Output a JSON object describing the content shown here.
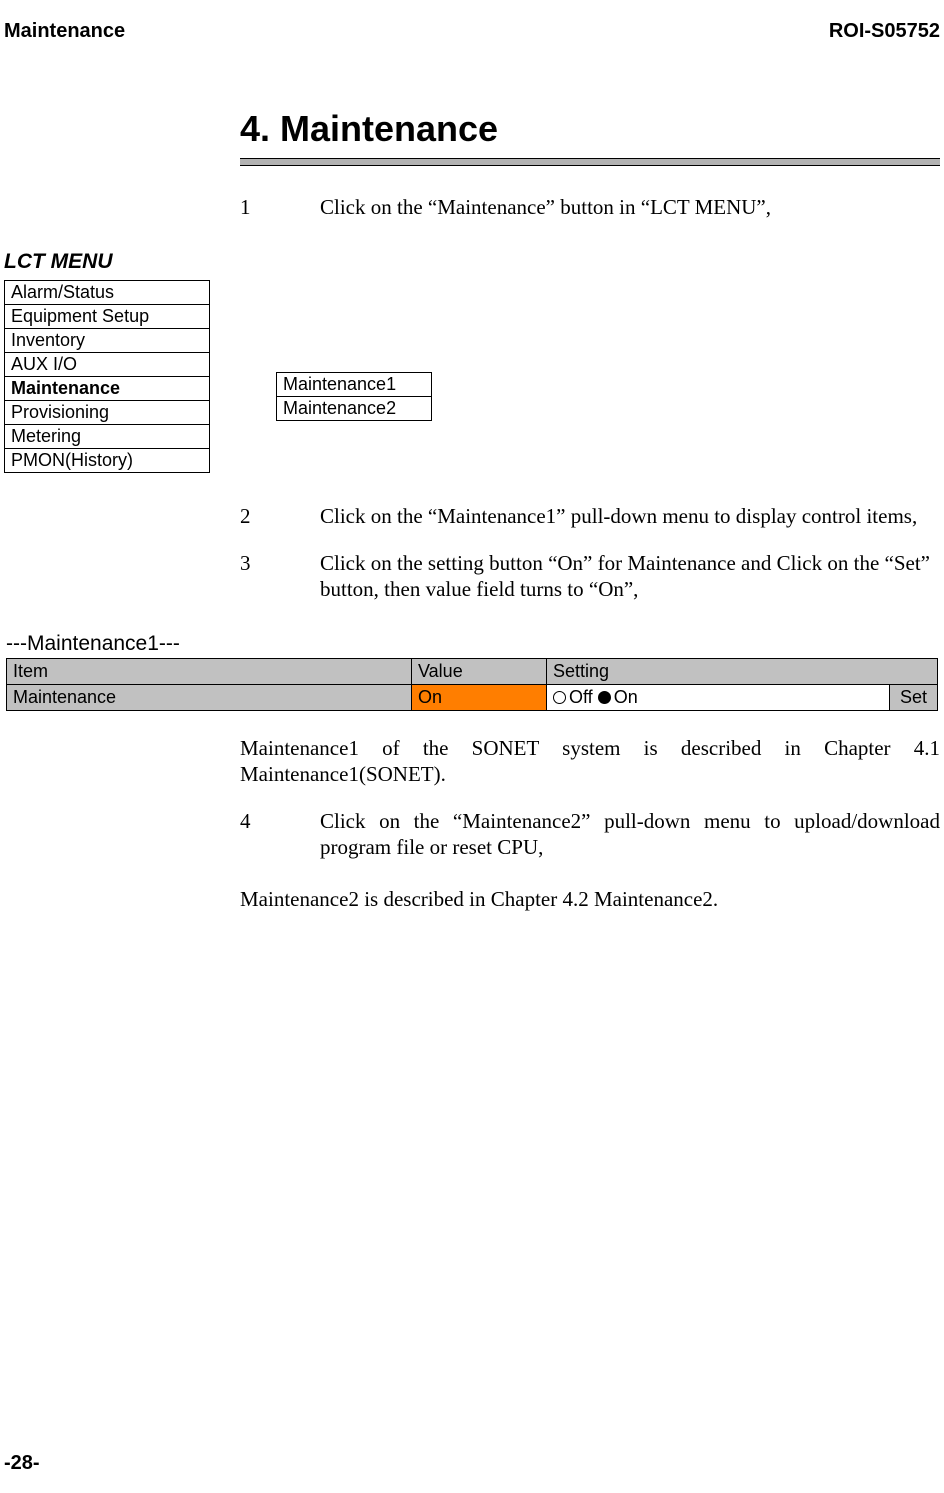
{
  "header": {
    "left": "Maintenance",
    "right": "ROI-S05752"
  },
  "section": {
    "title": "4.     Maintenance"
  },
  "steps": {
    "s1": {
      "num": "1",
      "text": "Click on the “Maintenance” button in “LCT MENU”,"
    },
    "s2": {
      "num": "2",
      "text": "Click on the “Maintenance1” pull-down menu to display control items,"
    },
    "s3": {
      "num": "3",
      "text": "Click on the setting button “On” for Maintenance and Click on the “Set” button, then value field turns to “On”,"
    },
    "s4": {
      "num": "4",
      "text": "Click on the “Maintenance2” pull-down menu to upload/download program file or reset CPU,"
    }
  },
  "lct": {
    "title": "LCT MENU",
    "items": [
      "Alarm/Status",
      "Equipment Setup",
      "Inventory",
      "AUX I/O",
      "Maintenance",
      "Provisioning",
      "Metering",
      "PMON(History)"
    ],
    "submenu": [
      "Maintenance1",
      "Maintenance2"
    ]
  },
  "m1": {
    "title": "---Maintenance1---",
    "head": {
      "item": "Item",
      "value": "Value",
      "setting": "Setting"
    },
    "row": {
      "item": "Maintenance",
      "value": "On",
      "off_label": "Off",
      "on_label": "On",
      "set": "Set"
    }
  },
  "paras": {
    "p1": "Maintenance1 of the SONET system is described in Chapter 4.1 Maintenance1(SONET).",
    "p2": "Maintenance2 is described in Chapter 4.2 Maintenance2."
  },
  "footer": {
    "page": "-28-"
  }
}
